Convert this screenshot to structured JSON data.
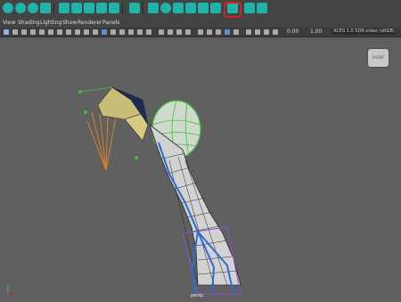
{
  "menu": [
    "View",
    "Shading",
    "Lighting",
    "Show",
    "Renderer",
    "Panels"
  ],
  "toolbar": {
    "field1": "0.00",
    "field2": "1.00",
    "colorspace": "ACES 1.0 SDR-video (sRGB)"
  },
  "viewport": {
    "viewcube_label": "FRONT",
    "camera_name": "persp"
  },
  "annotation": {
    "highlighted_tool": "red-circled shelf icon"
  },
  "colors": {
    "accent": "#19c6b9",
    "highlight": "#e0191b",
    "wireframe_green": "#3fbf3a",
    "joint_blue": "#2c6bd6",
    "ik_orange": "#d9822b"
  }
}
